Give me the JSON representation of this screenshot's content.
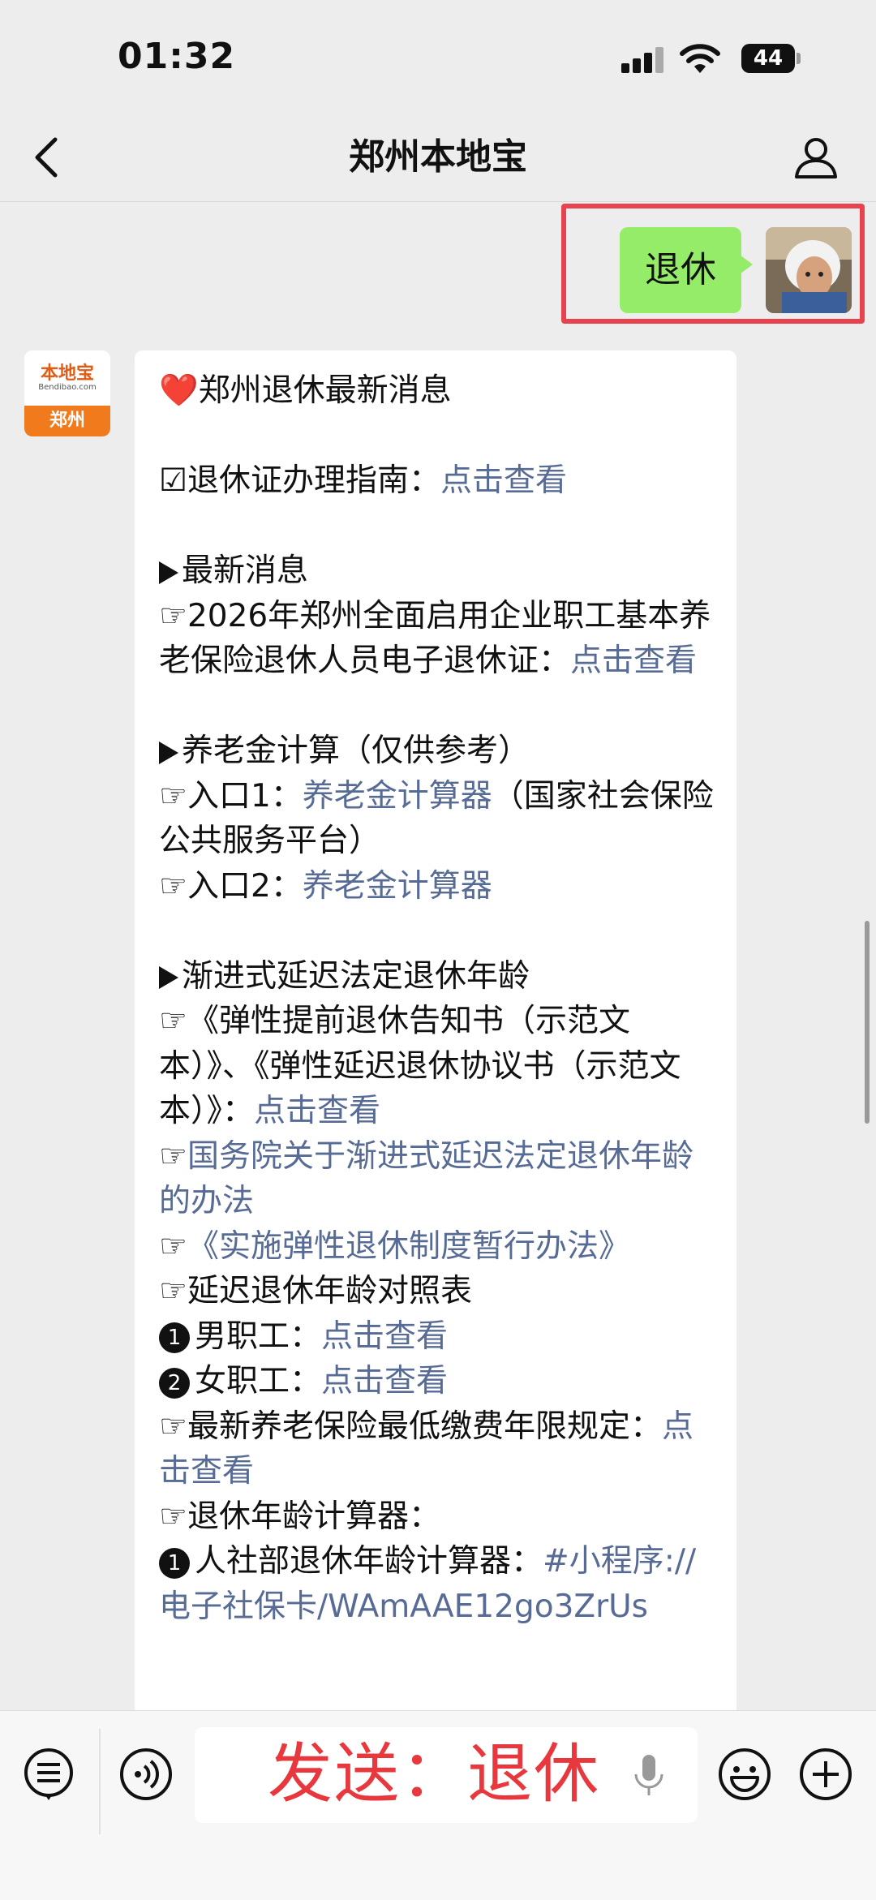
{
  "status_bar": {
    "time": "01:32",
    "battery": "44"
  },
  "nav": {
    "title": "郑州本地宝",
    "back_icon": "chevron-left-icon",
    "profile_icon": "person-icon"
  },
  "chat": {
    "sent": {
      "text": "退休"
    },
    "bot_avatar": {
      "logo_text": "本地宝",
      "logo_sub": "Bendibao.com",
      "city": "郑州"
    },
    "received_lines": [
      {
        "t": "text",
        "parts": [
          {
            "k": "heart",
            "v": "❤️"
          },
          {
            "k": "t",
            "v": "郑州退休最新消息"
          }
        ]
      },
      {
        "t": "blank"
      },
      {
        "t": "text",
        "parts": [
          {
            "k": "t",
            "v": "☑退休证办理指南："
          },
          {
            "k": "l",
            "v": "点击查看"
          }
        ]
      },
      {
        "t": "blank"
      },
      {
        "t": "text",
        "parts": [
          {
            "k": "tri",
            "v": ""
          },
          {
            "k": "t",
            "v": "最新消息"
          }
        ]
      },
      {
        "t": "text",
        "parts": [
          {
            "k": "t",
            "v": "☞2026年郑州全面启用企业职工基本养老保险退休人员电子退休证："
          },
          {
            "k": "l",
            "v": "点击查看"
          }
        ]
      },
      {
        "t": "blank"
      },
      {
        "t": "text",
        "parts": [
          {
            "k": "tri",
            "v": ""
          },
          {
            "k": "t",
            "v": "养老金计算（仅供参考）"
          }
        ]
      },
      {
        "t": "text",
        "parts": [
          {
            "k": "t",
            "v": "☞入口1："
          },
          {
            "k": "l",
            "v": "养老金计算器"
          },
          {
            "k": "t",
            "v": "（国家社会保险公共服务平台）"
          }
        ]
      },
      {
        "t": "text",
        "parts": [
          {
            "k": "t",
            "v": "☞入口2："
          },
          {
            "k": "l",
            "v": "养老金计算器"
          }
        ]
      },
      {
        "t": "blank"
      },
      {
        "t": "text",
        "parts": [
          {
            "k": "tri",
            "v": ""
          },
          {
            "k": "t",
            "v": "渐进式延迟法定退休年龄"
          }
        ]
      },
      {
        "t": "text",
        "parts": [
          {
            "k": "t",
            "v": "☞《弹性提前退休告知书（示范文本）》、《弹性延迟退休协议书（示范文本）》："
          },
          {
            "k": "l",
            "v": "点击查看"
          }
        ]
      },
      {
        "t": "text",
        "parts": [
          {
            "k": "t",
            "v": "☞"
          },
          {
            "k": "l",
            "v": "国务院关于渐进式延迟法定退休年龄的办法"
          }
        ]
      },
      {
        "t": "text",
        "parts": [
          {
            "k": "t",
            "v": "☞"
          },
          {
            "k": "l",
            "v": "《实施弹性退休制度暂行办法》"
          }
        ]
      },
      {
        "t": "text",
        "parts": [
          {
            "k": "t",
            "v": "☞延迟退休年龄对照表"
          }
        ]
      },
      {
        "t": "text",
        "parts": [
          {
            "k": "num",
            "v": "1"
          },
          {
            "k": "t",
            "v": "男职工："
          },
          {
            "k": "l",
            "v": "点击查看"
          }
        ]
      },
      {
        "t": "text",
        "parts": [
          {
            "k": "num",
            "v": "2"
          },
          {
            "k": "t",
            "v": "女职工："
          },
          {
            "k": "l",
            "v": "点击查看"
          }
        ]
      },
      {
        "t": "text",
        "parts": [
          {
            "k": "t",
            "v": "☞最新养老保险最低缴费年限规定："
          },
          {
            "k": "l",
            "v": "点击查看"
          }
        ]
      },
      {
        "t": "text",
        "parts": [
          {
            "k": "t",
            "v": "☞退休年龄计算器："
          }
        ]
      },
      {
        "t": "text",
        "parts": [
          {
            "k": "num",
            "v": "1"
          },
          {
            "k": "t",
            "v": "人社部退休年龄计算器："
          },
          {
            "k": "l",
            "v": "#小程序://电子社保卡/WAmAAE12go3ZrUs"
          }
        ]
      }
    ]
  },
  "input_bar": {
    "voice_list_icon": "chat-list-icon",
    "voice_icon": "voice-wave-icon",
    "text": "发送：退休",
    "mic_icon": "microphone-icon",
    "emoji_icon": "smiley-icon",
    "plus_icon": "plus-circle-icon"
  },
  "colors": {
    "link": "#576b95",
    "sent_bubble": "#95ec69",
    "highlight": "#e8424e",
    "overlay_text": "#e8383d"
  }
}
